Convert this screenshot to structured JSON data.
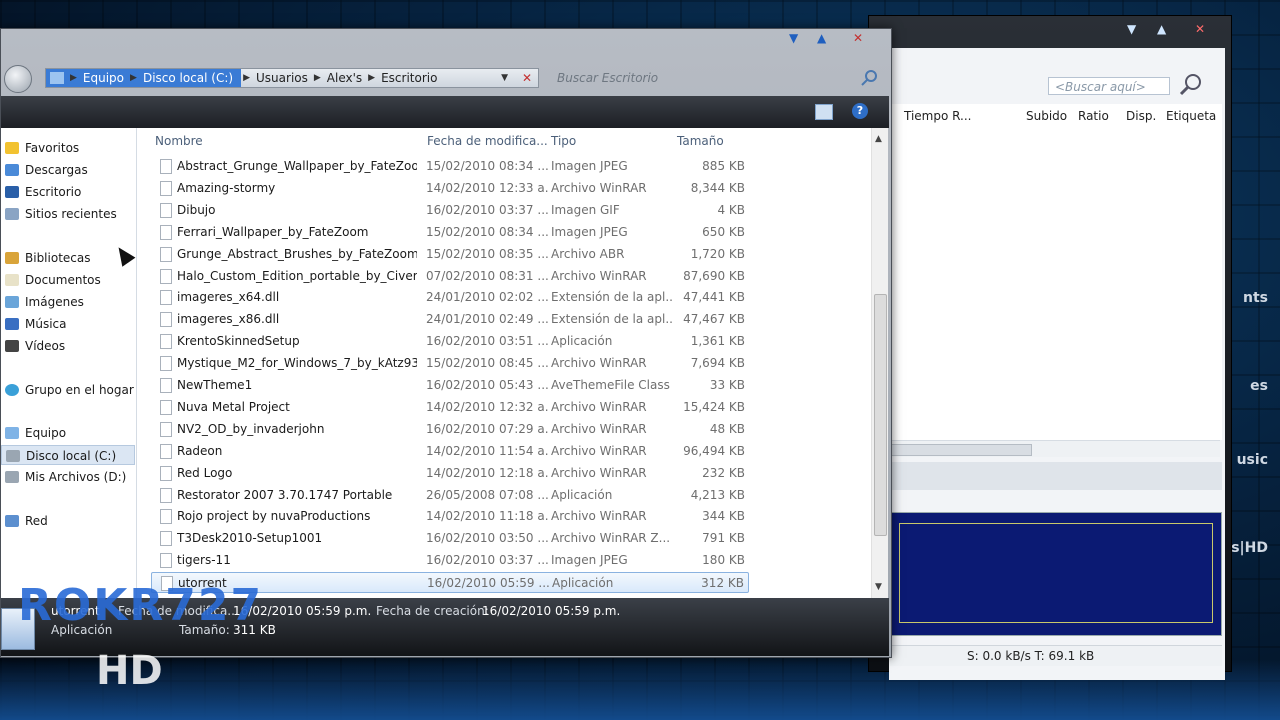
{
  "watermark": {
    "channel": "ROKR727",
    "hd": "HD"
  },
  "desktop_side_words": [
    "nts",
    "es",
    "usic",
    "s|HD"
  ],
  "utorrent": {
    "search_placeholder": "<Buscar aquí>",
    "columns": [
      "Tiempo R...",
      "Subido",
      "Ratio",
      "Disp.",
      "Etiqueta"
    ],
    "status": "S: 0.0 kB/s T: 69.1 kB"
  },
  "explorer": {
    "breadcrumb": [
      "Equipo",
      "Disco local (C:)",
      "Usuarios",
      "Alex's",
      "Escritorio"
    ],
    "search_placeholder": "Buscar Escritorio",
    "nav": {
      "favoritos": "Favoritos",
      "descargas": "Descargas",
      "escritorio": "Escritorio",
      "recientes": "Sitios recientes",
      "bibliotecas": "Bibliotecas",
      "documentos": "Documentos",
      "imagenes": "Imágenes",
      "musica": "Música",
      "videos": "Vídeos",
      "hogar": "Grupo en el hogar",
      "equipo": "Equipo",
      "disco_c": "Disco local (C:)",
      "disco_d": "Mis Archivos  (D:)",
      "red": "Red"
    },
    "headers": {
      "name": "Nombre",
      "date": "Fecha de modifica...",
      "type": "Tipo",
      "size": "Tamaño"
    },
    "files": [
      {
        "name": "Abstract_Grunge_Wallpaper_by_FateZoom",
        "date": "15/02/2010 08:34 ...",
        "type": "Imagen JPEG",
        "size": "885 KB"
      },
      {
        "name": "Amazing-stormy",
        "date": "14/02/2010 12:33 a...",
        "type": "Archivo WinRAR",
        "size": "8,344 KB"
      },
      {
        "name": "Dibujo",
        "date": "16/02/2010 03:37 ...",
        "type": "Imagen GIF",
        "size": "4 KB"
      },
      {
        "name": "Ferrari_Wallpaper_by_FateZoom",
        "date": "15/02/2010 08:34 ...",
        "type": "Imagen JPEG",
        "size": "650 KB"
      },
      {
        "name": "Grunge_Abstract_Brushes_by_FateZoom",
        "date": "15/02/2010 08:35 ...",
        "type": "Archivo ABR",
        "size": "1,720 KB"
      },
      {
        "name": "Halo_Custom_Edition_portable_by_Civerr...",
        "date": "07/02/2010 08:31 ...",
        "type": "Archivo WinRAR",
        "size": "87,690 KB"
      },
      {
        "name": "imageres_x64.dll",
        "date": "24/01/2010 02:02 ...",
        "type": "Extensión de la apl...",
        "size": "47,441 KB"
      },
      {
        "name": "imageres_x86.dll",
        "date": "24/01/2010 02:49 ...",
        "type": "Extensión de la apl...",
        "size": "47,467 KB"
      },
      {
        "name": "KrentoSkinnedSetup",
        "date": "16/02/2010 03:51 ...",
        "type": "Aplicación",
        "size": "1,361 KB"
      },
      {
        "name": "Mystique_M2_for_Windows_7_by_kAtz93",
        "date": "15/02/2010 08:45 ...",
        "type": "Archivo WinRAR",
        "size": "7,694 KB"
      },
      {
        "name": "NewTheme1",
        "date": "16/02/2010 05:43 ...",
        "type": "AveThemeFile Class",
        "size": "33 KB"
      },
      {
        "name": "Nuva Metal Project",
        "date": "14/02/2010 12:32 a...",
        "type": "Archivo WinRAR",
        "size": "15,424 KB"
      },
      {
        "name": "NV2_OD_by_invaderjohn",
        "date": "16/02/2010 07:29 a...",
        "type": "Archivo WinRAR",
        "size": "48 KB"
      },
      {
        "name": "Radeon",
        "date": "14/02/2010 11:54 a...",
        "type": "Archivo WinRAR",
        "size": "96,494 KB"
      },
      {
        "name": "Red Logo",
        "date": "14/02/2010 12:18 a...",
        "type": "Archivo WinRAR",
        "size": "232 KB"
      },
      {
        "name": "Restorator 2007 3.70.1747 Portable",
        "date": "26/05/2008 07:08 ...",
        "type": "Aplicación",
        "size": "4,213 KB"
      },
      {
        "name": "Rojo project by nuvaProductions",
        "date": "14/02/2010 11:18 a...",
        "type": "Archivo WinRAR",
        "size": "344 KB"
      },
      {
        "name": "T3Desk2010-Setup1001",
        "date": "16/02/2010 03:50 ...",
        "type": "Archivo WinRAR Z...",
        "size": "791 KB"
      },
      {
        "name": "tigers-11",
        "date": "16/02/2010 03:37 ...",
        "type": "Imagen JPEG",
        "size": "180 KB"
      },
      {
        "name": "utorrent",
        "date": "16/02/2010 05:59 ...",
        "type": "Aplicación",
        "size": "312 KB"
      }
    ],
    "details": {
      "name": "utorrent",
      "kind": "Aplicación",
      "mod_label": "Fecha de modifica...",
      "mod_value": "16/02/2010 05:59 p.m.",
      "size_label": "Tamaño:",
      "size_value": "311 KB",
      "created_label": "Fecha de creación:",
      "created_value": "16/02/2010 05:59 p.m."
    }
  }
}
